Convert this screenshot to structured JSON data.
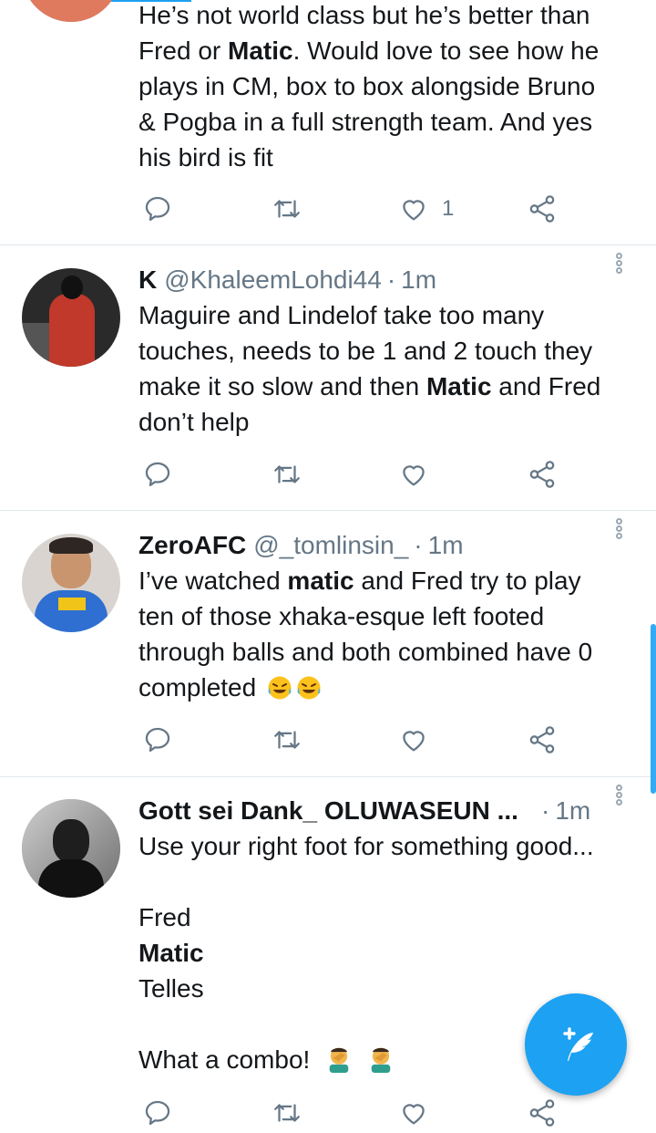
{
  "tweets": [
    {
      "body_lines": [
        "He’s not world class but he’s better than",
        "Fred or ",
        "Matic",
        ". Would love to see how he",
        "plays in CM, box to box alongside Bruno",
        "& Pogba in a full strength team. And yes",
        "his bird is fit"
      ],
      "likes": "1"
    },
    {
      "name": "K",
      "handle": "@KhaleemLohdi44",
      "sep": "·",
      "time": "1m",
      "body": {
        "l1": "Maguire and Lindelof take too many",
        "l2": "touches, needs to be 1 and 2 touch they",
        "l3a": "make it so slow and then ",
        "l3b": "Matic",
        "l3c": " and Fred",
        "l4": "don’t help"
      }
    },
    {
      "name": "ZeroAFC",
      "handle": "@_tomlinsin_",
      "sep": "·",
      "time": "1m",
      "body": {
        "l1a": "I’ve watched ",
        "l1b": "matic",
        "l1c": " and Fred  try to play",
        "l2": "ten of those xhaka-esque left footed",
        "l3": "through balls and both combined have 0",
        "l4": "completed"
      },
      "emoji": [
        "face-with-tears-of-joy",
        "face-with-tears-of-joy"
      ]
    },
    {
      "name": "Gott sei Dank_ OLUWASEUN ...",
      "sep": "·",
      "time": "1m",
      "body": {
        "l1": "Use your right foot for something good...",
        "l2": "Fred",
        "l3": "Matic",
        "l4": "Telles",
        "l5": "What a combo!"
      },
      "emoji": [
        "man-facepalming",
        "man-facepalming"
      ]
    }
  ],
  "icons": {
    "reply": "reply-icon",
    "retweet": "retweet-icon",
    "like": "heart-icon",
    "share": "share-icon",
    "more": "more-vertical-icon",
    "compose": "compose-tweet-icon"
  },
  "colors": {
    "accent": "#1da1f2",
    "secondary_text": "#657786",
    "divider": "#e1e8ed"
  }
}
